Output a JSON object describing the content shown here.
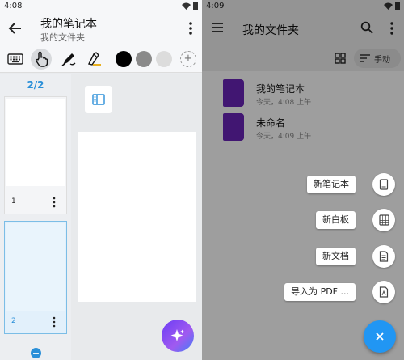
{
  "left": {
    "status": {
      "time": "4:08"
    },
    "appbar": {
      "title": "我的笔记本",
      "subtitle": "我的文件夹"
    },
    "toolbar": {
      "tools": [
        "keyboard-icon",
        "hand-touch-icon",
        "pen-icon",
        "highlighter-icon"
      ],
      "selected_tool": "hand-touch-icon",
      "colors": [
        "#000000",
        "#8a8a8a",
        "#dcdcdc"
      ]
    },
    "thumbs": {
      "page_indicator": "2/2",
      "pages": [
        {
          "num": "1"
        },
        {
          "num": "2",
          "active": true
        }
      ]
    }
  },
  "right": {
    "status": {
      "time": "4:09"
    },
    "appbar": {
      "title": "我的文件夹"
    },
    "filter": {
      "sort_label": "手动"
    },
    "notes": [
      {
        "name": "我的笔记本",
        "time": "今天，4:08 上午"
      },
      {
        "name": "未命名",
        "time": "今天，4:09 上午"
      }
    ],
    "fab_menu": [
      {
        "label": "新笔记本",
        "icon": "notebook-icon"
      },
      {
        "label": "新白板",
        "icon": "whiteboard-icon"
      },
      {
        "label": "新文档",
        "icon": "document-icon"
      },
      {
        "label": "导入为 PDF ...",
        "icon": "pdf-import-icon"
      }
    ],
    "colors": {
      "accent": "#2196f3",
      "notebook": "#6a24b8"
    }
  }
}
